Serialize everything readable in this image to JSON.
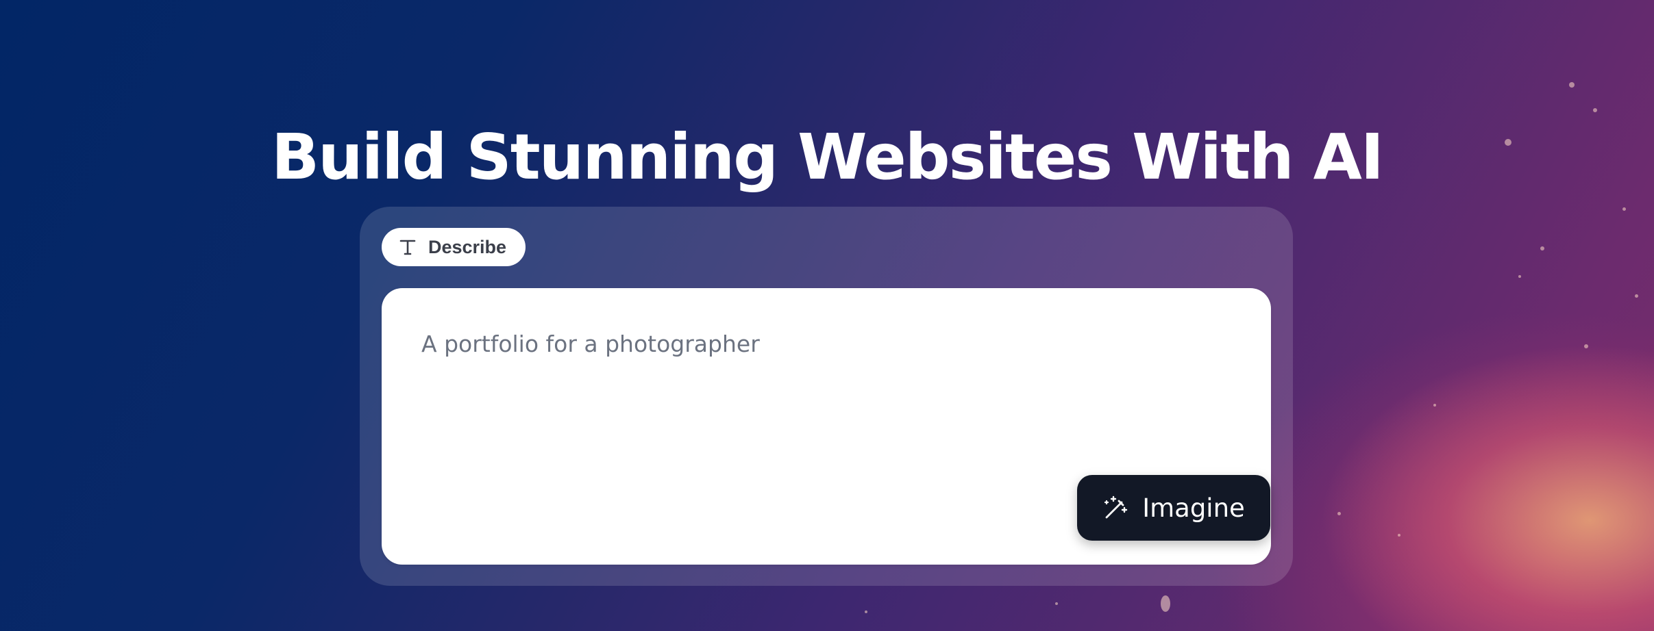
{
  "hero": {
    "title": "Build Stunning Websites With AI"
  },
  "prompt_card": {
    "mode_label": "Describe",
    "mode_icon": "text-type-icon",
    "placeholder": "A portfolio for a photographer",
    "value": "",
    "submit_label": "Imagine",
    "submit_icon": "magic-wand-icon"
  },
  "colors": {
    "button_bg": "#121826",
    "card_bg": "#ffffff",
    "title_text": "#ffffff",
    "placeholder_text": "#6b7280"
  }
}
